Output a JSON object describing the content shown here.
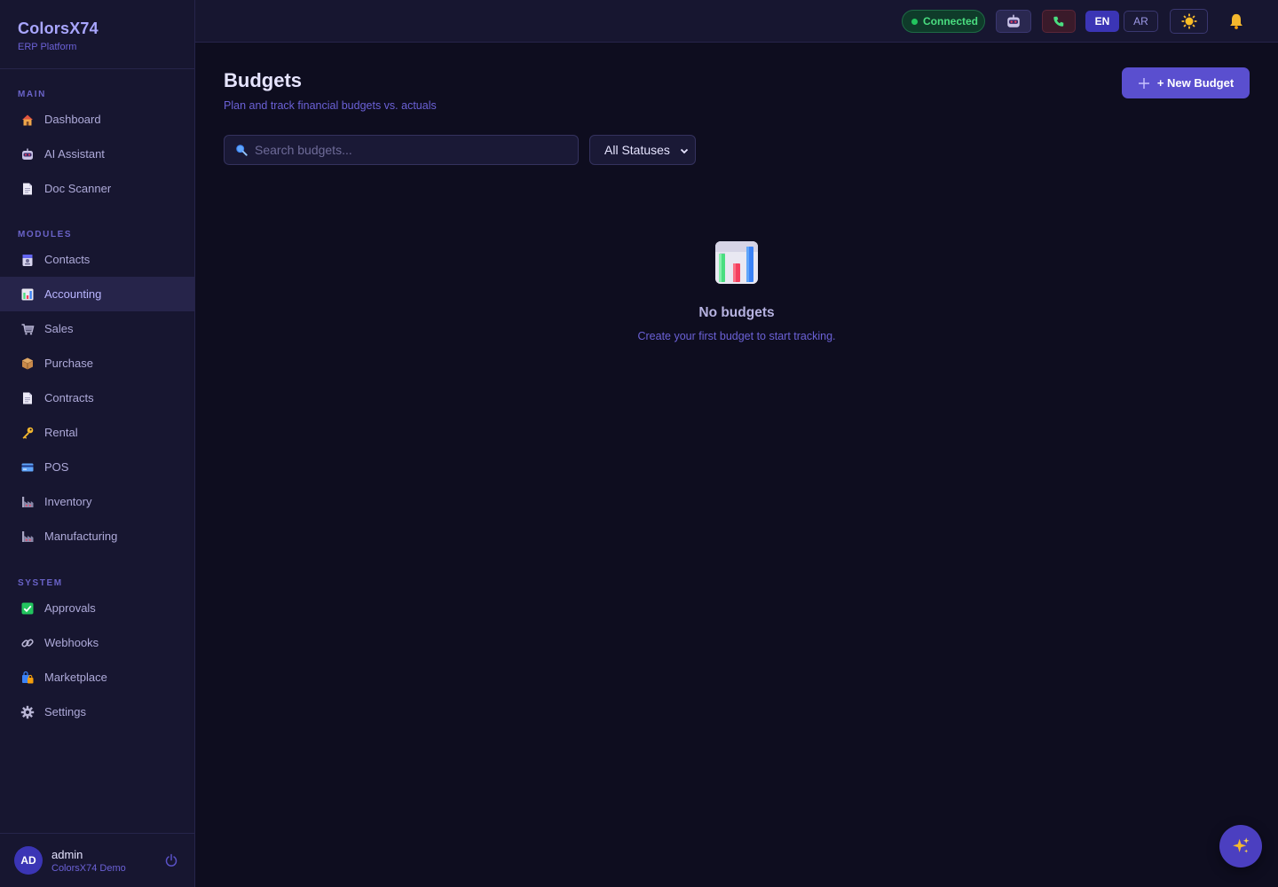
{
  "brand": {
    "title": "ColorsX74",
    "subtitle": "ERP Platform"
  },
  "sidebar": {
    "sections": [
      {
        "label": "MAIN",
        "items": [
          {
            "label": "Dashboard",
            "icon": "house-icon"
          },
          {
            "label": "AI Assistant",
            "icon": "robot-icon"
          },
          {
            "label": "Doc Scanner",
            "icon": "document-icon"
          }
        ]
      },
      {
        "label": "MODULES",
        "items": [
          {
            "label": "Contacts",
            "icon": "contact-card-icon"
          },
          {
            "label": "Accounting",
            "icon": "bar-chart-icon",
            "active": true
          },
          {
            "label": "Sales",
            "icon": "cart-icon"
          },
          {
            "label": "Purchase",
            "icon": "package-icon"
          },
          {
            "label": "Contracts",
            "icon": "document-icon"
          },
          {
            "label": "Rental",
            "icon": "key-icon"
          },
          {
            "label": "POS",
            "icon": "credit-card-icon"
          },
          {
            "label": "Inventory",
            "icon": "factory-icon"
          },
          {
            "label": "Manufacturing",
            "icon": "factory-icon"
          }
        ]
      },
      {
        "label": "SYSTEM",
        "items": [
          {
            "label": "Approvals",
            "icon": "check-box-icon"
          },
          {
            "label": "Webhooks",
            "icon": "link-icon"
          },
          {
            "label": "Marketplace",
            "icon": "shopping-bags-icon"
          },
          {
            "label": "Settings",
            "icon": "gear-icon"
          }
        ]
      }
    ]
  },
  "user": {
    "initials": "AD",
    "name": "admin",
    "org": "ColorsX74 Demo"
  },
  "topbar": {
    "status": "Connected",
    "lang_en": "EN",
    "lang_ar": "AR"
  },
  "page": {
    "title": "Budgets",
    "subtitle": "Plan and track financial budgets vs. actuals",
    "new_button": "+ New Budget",
    "search_placeholder": "Search budgets...",
    "status_filter": "All Statuses"
  },
  "empty_state": {
    "title": "No budgets",
    "message": "Create your first budget to start tracking."
  },
  "colors": {
    "accent": "#5a4fcf",
    "sidebar_bg": "#171630",
    "main_bg": "#0e0d1f",
    "connected": "#22c55e"
  }
}
